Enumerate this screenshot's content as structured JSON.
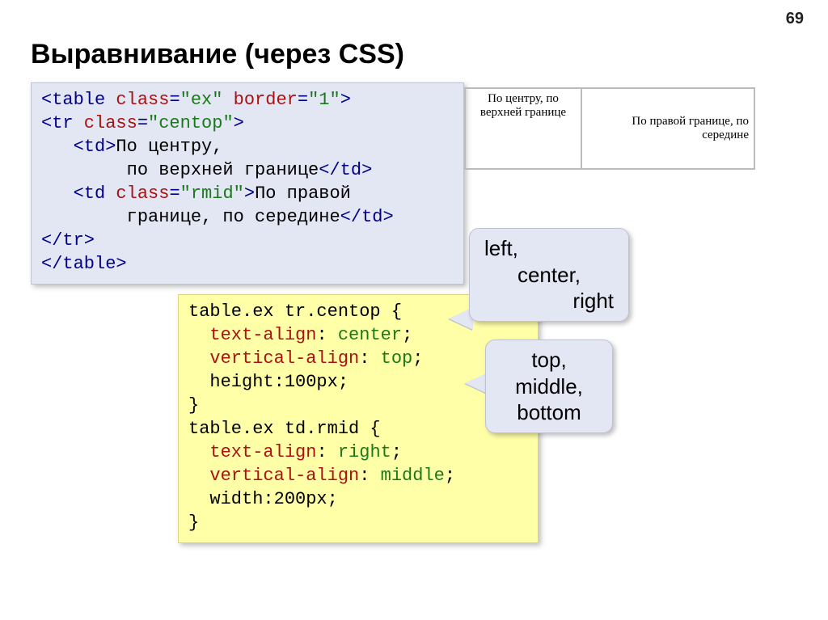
{
  "page_number": "69",
  "title": "Выравнивание (через CSS)",
  "html_code": {
    "l1a": "<table",
    "l1b": " class",
    "l1c": "=",
    "l1d": "\"ex\"",
    "l1e": " border",
    "l1f": "=",
    "l1g": "\"1\"",
    "l1h": ">",
    "l2a": "<tr",
    "l2b": " class",
    "l2c": "=",
    "l2d": "\"centop\"",
    "l2e": ">",
    "l3a": "   <td>",
    "l3b": "По центру,",
    "l4a": "        по верхней границе",
    "l4b": "</td>",
    "l5a": "   <td",
    "l5b": " class",
    "l5c": "=",
    "l5d": "\"rmid\"",
    "l5e": ">",
    "l5f": "По правой",
    "l6a": "        границе, по середине",
    "l6b": "</td>",
    "l7": "</tr>",
    "l8": "</table>"
  },
  "css_code": {
    "l1": "table.ex tr.centop {",
    "l2a": "  ",
    "l2b": "text-align",
    "l2c": ": ",
    "l2d": "center",
    "l2e": ";",
    "l3a": "  ",
    "l3b": "vertical-align",
    "l3c": ": ",
    "l3d": "top",
    "l3e": ";",
    "l4a": "  ",
    "l4b": "height:100px;",
    "l5": "}",
    "l6": "table.ex td.rmid {",
    "l7a": "  ",
    "l7b": "text-align",
    "l7c": ": ",
    "l7d": "right",
    "l7e": ";",
    "l8a": "  ",
    "l8b": "vertical-align",
    "l8c": ": ",
    "l8d": "middle",
    "l8e": ";",
    "l9a": "  ",
    "l9b": "width:200px;",
    "l10": "}"
  },
  "table_example": {
    "cell1": "По центру, по верхней границе",
    "cell2": "По правой границе, по середине"
  },
  "callout1": {
    "l1": "left,",
    "l2": "center,",
    "l3": "right"
  },
  "callout2": {
    "l1": "top,",
    "l2": "middle,",
    "l3": "bottom"
  }
}
